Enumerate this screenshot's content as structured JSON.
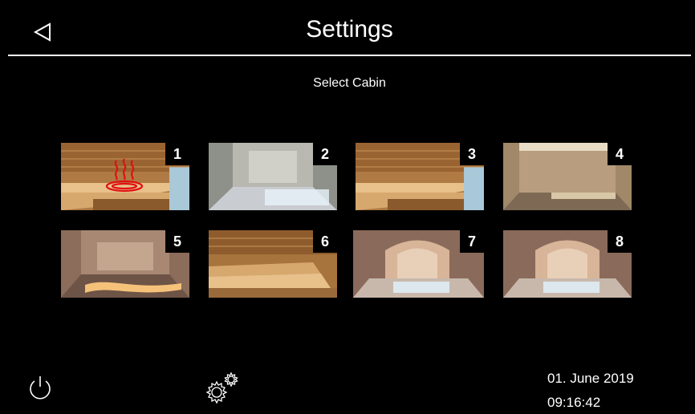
{
  "header": {
    "title": "Settings",
    "back_icon": "back-triangle-icon"
  },
  "main": {
    "subtitle": "Select Cabin",
    "cabins": [
      {
        "number": "1",
        "theme": "wood-sauna",
        "active": true
      },
      {
        "number": "2",
        "theme": "steam-bath"
      },
      {
        "number": "3",
        "theme": "wood-sauna"
      },
      {
        "number": "4",
        "theme": "stone-cabin"
      },
      {
        "number": "5",
        "theme": "tiled-cabin"
      },
      {
        "number": "6",
        "theme": "wood-sauna"
      },
      {
        "number": "7",
        "theme": "hammam"
      },
      {
        "number": "8",
        "theme": "hammam"
      }
    ],
    "active_icon": "heating-icon",
    "active_color": "#e01010"
  },
  "footer": {
    "power_icon": "power-icon",
    "settings_icon": "gears-icon",
    "date": "01. June 2019",
    "time": "09:16:42"
  }
}
